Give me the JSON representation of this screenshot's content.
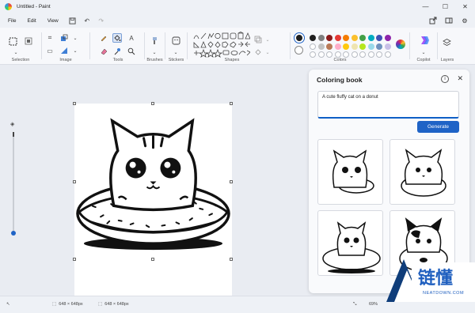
{
  "window": {
    "title": "Untitled - Paint"
  },
  "menu": {
    "items": [
      "File",
      "Edit",
      "View"
    ]
  },
  "ribbon": {
    "groups": {
      "selection": "Selection",
      "image": "Image",
      "tools": "Tools",
      "brushes": "Brushes",
      "stickers": "Stickers",
      "shapes": "Shapes",
      "colors": "Colors",
      "copilot": "Copilot",
      "layers": "Layers"
    },
    "colors_row1": [
      "#1f1f1f",
      "#7f7f7f",
      "#8b1a1a",
      "#e53935",
      "#f57c00",
      "#fbc02d",
      "#43a047",
      "#00acc1",
      "#3f51b5",
      "#8e24aa"
    ],
    "colors_row2": [
      "#ffffff",
      "#c3c3c3",
      "#b97a57",
      "#ffaec9",
      "#ffc90e",
      "#efe4b0",
      "#b5e61d",
      "#99d9ea",
      "#7092be",
      "#c8bfe7"
    ],
    "primary_color": "#1f1f1f",
    "secondary_color": "#ffffff",
    "accent_color": "#1f63c6"
  },
  "panel": {
    "title": "Coloring book",
    "prompt": "A cute fluffy cat on a donut",
    "generate_label": "Generate"
  },
  "status": {
    "selection_size": "648 × 648px",
    "canvas_size": "648 × 648px",
    "zoom": "69%"
  },
  "watermark": {
    "text": "链懂",
    "url": "NEATDOWN.COM"
  },
  "icons": [
    "paint-app-icon",
    "save-icon",
    "undo-icon",
    "redo-icon",
    "share-icon",
    "layout-icon",
    "settings-icon",
    "info-icon",
    "close-icon"
  ]
}
